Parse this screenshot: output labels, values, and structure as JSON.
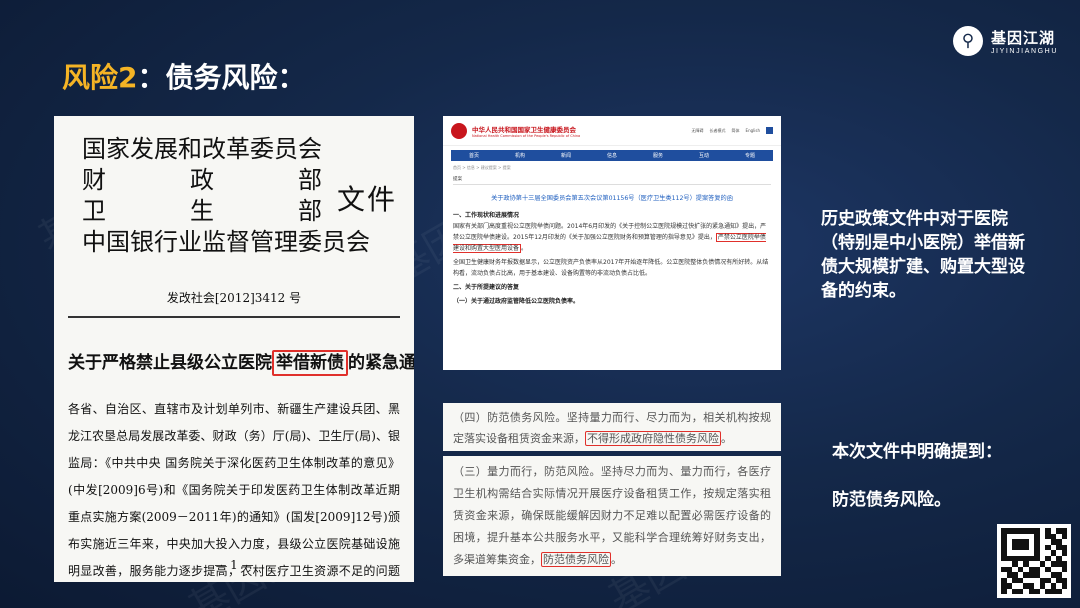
{
  "slide": {
    "title_risk": "风险2",
    "title_rest": "：债务风险：",
    "watermark": "基因江湖"
  },
  "logo": {
    "name": "基因江湖",
    "en": "JIYINJIANGHU"
  },
  "doc_left": {
    "issuer_lines": [
      [
        "国",
        "家",
        "发",
        "展",
        "和",
        "改",
        "革",
        "委",
        "员",
        "会"
      ],
      [
        "财",
        "政",
        "部"
      ],
      [
        "卫",
        "生",
        "部"
      ],
      [
        "中",
        "国",
        "银",
        "行",
        "业",
        "监",
        "督",
        "管",
        "理",
        "委",
        "员",
        "会"
      ]
    ],
    "doc_word": "文件",
    "doc_number": "发改社会[2012]3412 号",
    "heading_before": "关于严格禁止县级公立医院",
    "heading_highlight": "举借新债",
    "heading_after": "的紧急通知",
    "body": "各省、自治区、直辖市及计划单列市、新疆生产建设兵团、黑龙江农垦总局发展改革委、财政（务）厅(局)、卫生厅(局)、银监局：《中共中央 国务院关于深化医药卫生体制改革的意见》(中发[2009]6号)和《国务院关于印发医药卫生体制改革近期重点实施方案(2009－2011年)的通知》(国发[2009]12号)颁布实施近三年来，中央加大投入力度，县级公立医院基础设施明显改善，服务能力逐步提高，农村医疗卫生资源不足的问题得到有效缓解。但",
    "page": "— 1 —"
  },
  "web": {
    "site_title": "中华人民共和国国家卫生健康委员会",
    "site_sub": "National Health Commission of the People's Republic of China",
    "tools": [
      "无障碍",
      "长者模式",
      "简体",
      "English"
    ],
    "nav": [
      "首页",
      "机构",
      "新闻",
      "信息",
      "服务",
      "互动",
      "专题"
    ],
    "crumb": "首页 > 信息 > 建议提案 > 提案",
    "tab": "提案",
    "link_title": "关于政协第十三届全国委员会第五次会议第01156号（医疗卫生类112号）提案答复的函",
    "h1": "一、工作现状和进展情况",
    "p1_before": "国家有关部门高度重视公立医院举债问题。2014年6月印发的《关于控制公立医院规模过快扩张的紧急通知》提出，严禁公立医院举债建设。2015年12月印发的《关于加强公立医院财务和预算管理的指导意见》提出，",
    "p1_highlight": "严禁公立医院举债建设和购置大型医用设备",
    "p1_after": "。",
    "p2": "全国卫生健康财务年报数据显示，公立医院资产负债率从2017年开始逐年降低。公立医院整体负债情况有所好转。从结构看，流动负债占比高，用于基本建设、设备购置等的非流动负债占比低。",
    "h2": "二、关于所提建议的答复",
    "h3": "（一）关于通过政府监管降低公立医院负债率。"
  },
  "snippet1": {
    "before": "（四）防范债务风险。坚持量力而行、尽力而为，相关机构按规定落实设备租赁资金来源，",
    "highlight": "不得形成政府隐性债务风险",
    "after": "。"
  },
  "snippet2": {
    "before": "（三）量力而行，防范风险。坚持尽力而为、量力而行，各医疗卫生机构需结合实际情况开展医疗设备租赁工作，按规定落实租赁资金来源，确保既能缓解因财力不足难以配置必需医疗设备的困境，提升基本公共服务水平，又能科学合理统筹好财务支出，多渠道筹集资金，",
    "highlight": "防范债务风险",
    "after": "。"
  },
  "side": {
    "text1": "历史政策文件中对于医院（特别是中小医院）举借新债大规模扩建、购置大型设备的约束。",
    "text2": "本次文件中明确提到：",
    "text3": "防范债务风险。"
  }
}
